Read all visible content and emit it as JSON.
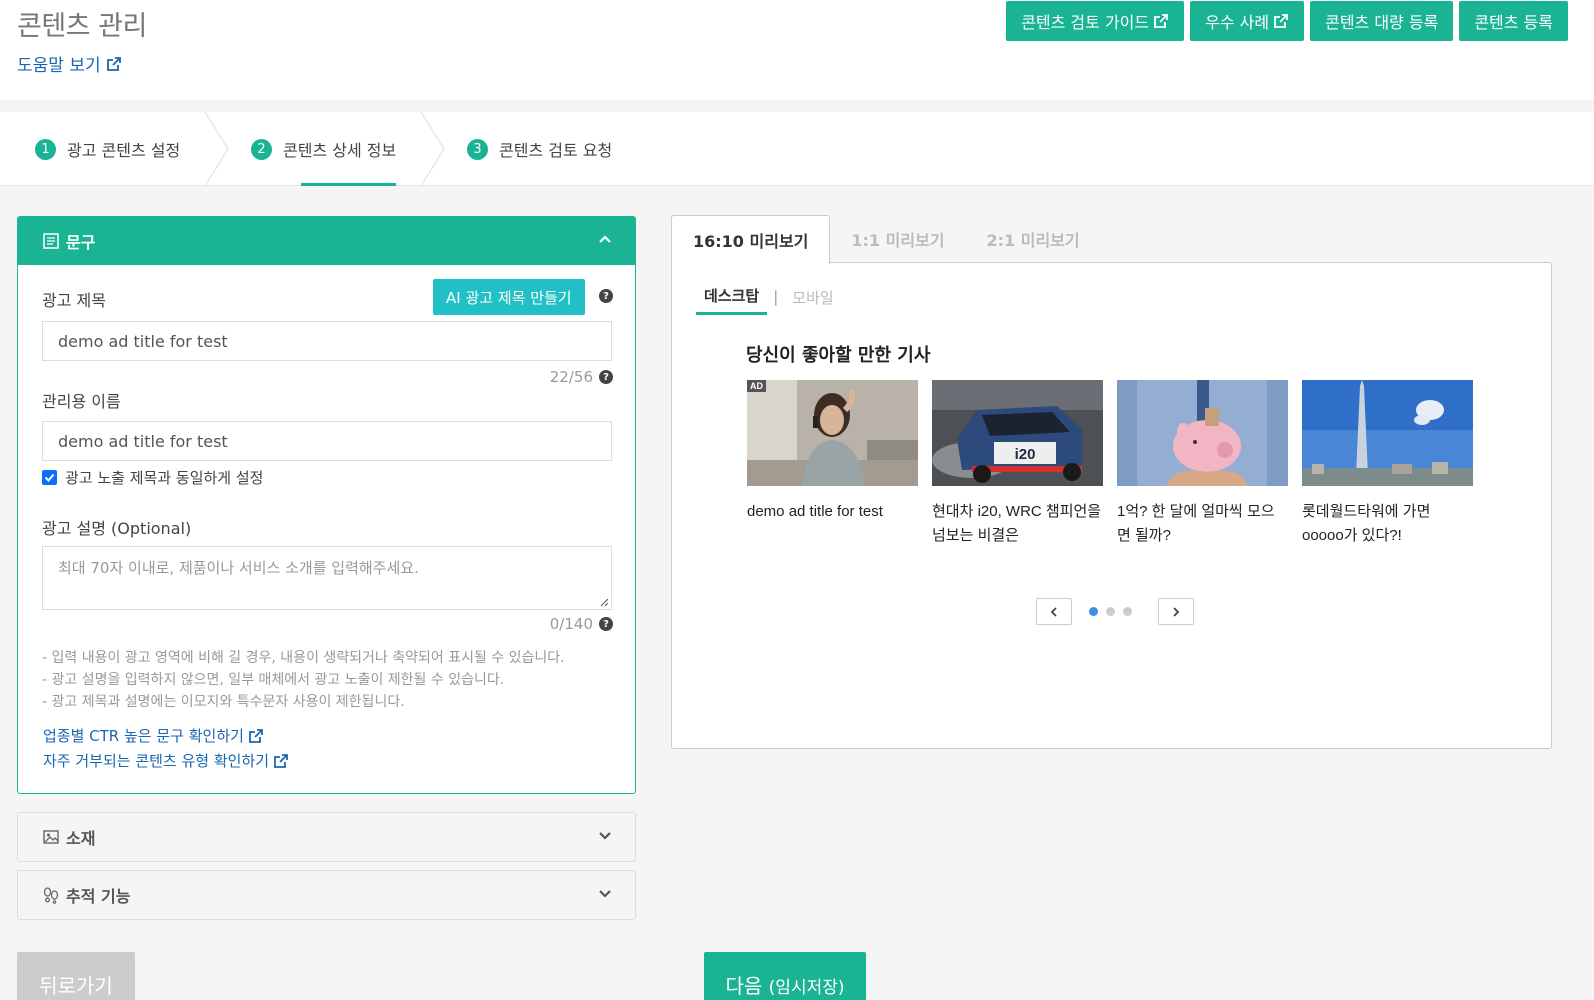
{
  "header": {
    "title": "콘텐츠 관리",
    "help_link": "도움말 보기",
    "buttons": [
      "콘텐츠 검토 가이드",
      "우수 사례",
      "콘텐츠 대량 등록",
      "콘텐츠 등록"
    ]
  },
  "steps": [
    {
      "num": "1",
      "label": "광고 콘텐츠 설정"
    },
    {
      "num": "2",
      "label": "콘텐츠 상세 정보"
    },
    {
      "num": "3",
      "label": "콘텐츠 검토 요청"
    }
  ],
  "copy_section": {
    "title": "문구",
    "ad_title_label": "광고 제목",
    "ai_button": "AI 광고 제목 만들기",
    "ad_title_value": "demo ad title for test",
    "ad_title_counter": "22/56",
    "admin_name_label": "관리용 이름",
    "admin_name_value": "demo ad title for test",
    "same_title_checkbox": "광고 노출 제목과 동일하게 설정",
    "desc_label": "광고 설명 (Optional)",
    "desc_placeholder": "최대 70자 이내로, 제품이나 서비스 소개를 입력해주세요.",
    "desc_counter": "0/140",
    "notes": [
      "- 입력 내용이 광고 영역에 비해 길 경우, 내용이 생략되거나 축약되어 표시될 수 있습니다.",
      "- 광고 설명을 입력하지 않으면, 일부 매체에서 광고 노출이 제한될 수 있습니다.",
      "- 광고 제목과 설명에는 이모지와 특수문자 사용이 제한됩니다."
    ],
    "link_ctr": "업종별 CTR 높은 문구 확인하기",
    "link_rejected": "자주 거부되는 콘텐츠 유형 확인하기"
  },
  "material_section": {
    "title": "소재"
  },
  "tracking_section": {
    "title": "추적 기능"
  },
  "footer": {
    "back": "뒤로가기",
    "next": "다음",
    "next_sub": "(임시저장)"
  },
  "preview": {
    "tabs": [
      "16:10 미리보기",
      "1:1 미리보기",
      "2:1 미리보기"
    ],
    "device_tabs": [
      "데스크탑",
      "모바일"
    ],
    "device_separator": "|",
    "widget_title": "당신이 좋아할 만한 기사",
    "ad_tag": "AD",
    "cards": [
      {
        "title": "demo ad title for test",
        "image": "woman-on-phone"
      },
      {
        "title": "현대차 i20, WRC 챔피언을 넘보는 비결은",
        "image": "rally-car"
      },
      {
        "title": "1억? 한 달에 얼마씩 모으면 될까?",
        "image": "piggy-bank"
      },
      {
        "title": "롯데월드타워에 가면 ooooo가 있다?!",
        "image": "tower-skyline"
      }
    ],
    "pager_active": 1,
    "pager_total": 3
  },
  "colors": {
    "accent": "#1ab394",
    "ai_button": "#21c0c6",
    "link": "#1a66b5",
    "pager_active": "#3d8fe0"
  }
}
